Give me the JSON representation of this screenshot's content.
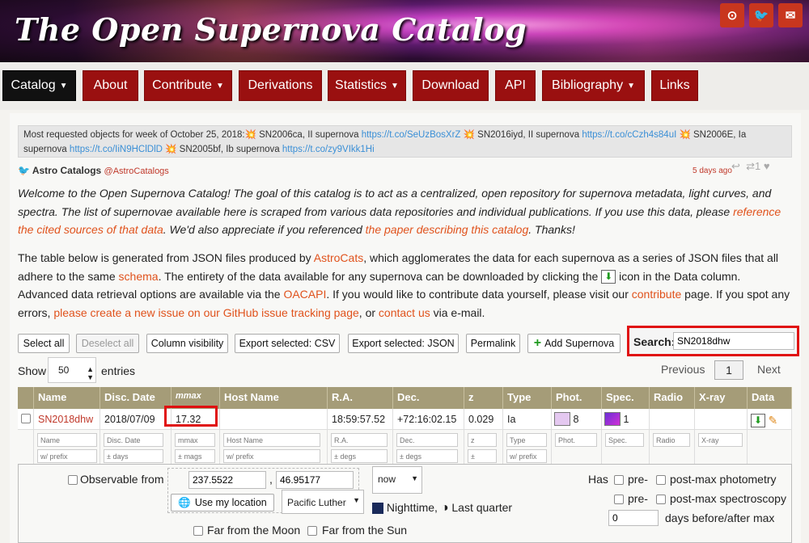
{
  "header": {
    "title": "The Open Supernova Catalog",
    "social": [
      {
        "name": "github-icon",
        "glyph": "⊙"
      },
      {
        "name": "twitter-icon",
        "glyph": "🐦"
      },
      {
        "name": "email-icon",
        "glyph": "✉"
      }
    ]
  },
  "nav": {
    "items": [
      {
        "label": "Catalog",
        "dropdown": true,
        "active": true
      },
      {
        "label": "About",
        "dropdown": false
      },
      {
        "label": "Contribute",
        "dropdown": true
      },
      {
        "label": "Derivations",
        "dropdown": false
      },
      {
        "label": "Statistics",
        "dropdown": true
      },
      {
        "label": "Download",
        "dropdown": false
      },
      {
        "label": "API",
        "dropdown": false
      },
      {
        "label": "Bibliography",
        "dropdown": true
      },
      {
        "label": "Links",
        "dropdown": false
      }
    ]
  },
  "ticker": {
    "intro": "Most requested objects for week of October 25, 2018:",
    "items": [
      {
        "text": "SN2006ca, II supernova",
        "link": "https://t.co/SeUzBosXrZ"
      },
      {
        "text": "SN2016iyd, II supernova",
        "link": "https://t.co/cCzh4s84uI"
      },
      {
        "text": "SN2006E, Ia supernova",
        "link": "https://t.co/IiN9HClDlD"
      },
      {
        "text": "SN2005bf, Ib supernova",
        "link": "https://t.co/zy9VIkk1Hi"
      }
    ]
  },
  "tweet": {
    "user": "Astro Catalogs",
    "handle": "@AstroCatalogs",
    "time": "5 days ago",
    "retweets": "1"
  },
  "intro": {
    "text1": "Welcome to the Open Supernova Catalog! The goal of this catalog is to act as a centralized, open repository for supernova metadata, light curves, and spectra. The list of supernovae available here is scraped from various data repositories and individual publications. If you use this data, please ",
    "link1": "reference the cited sources of that data",
    "text2": ". We'd also appreciate if you referenced ",
    "link2": "the paper describing this catalog",
    "text3": ". Thanks!"
  },
  "para2": {
    "t1": "The table below is generated from JSON files produced by ",
    "l1": "AstroCats",
    "t2": ", which agglomerates the data for each supernova as a series of JSON files that all adhere to the same ",
    "l2": "schema",
    "t3": ". The entirety of the data available for any supernova can be downloaded by clicking the ",
    "t4": " icon in the Data column. Advanced data retrieval options are available via the ",
    "l3": "OACAPI",
    "t5": ". If you would like to contribute data yourself, please visit our ",
    "l4": "contribute",
    "t6": " page. If you spot any errors, ",
    "l5": "please create a new issue on our GitHub issue tracking page",
    "t7": ", or ",
    "l6": "contact us",
    "t8": " via e-mail."
  },
  "toolbar": {
    "select_all": "Select all",
    "deselect_all": "Deselect all",
    "column_visibility": "Column visibility",
    "export_csv": "Export selected: CSV",
    "export_json": "Export selected: JSON",
    "permalink": "Permalink",
    "add_supernova": "Add Supernova",
    "search_label": "Search:",
    "search_value": "SN2018dhw"
  },
  "pagination": {
    "show": "Show",
    "entries_value": "50",
    "entries": "entries",
    "previous": "Previous",
    "page": "1",
    "next": "Next"
  },
  "table": {
    "headers": [
      "",
      "Name",
      "Disc. Date",
      "mmax",
      "Host Name",
      "R.A.",
      "Dec.",
      "z",
      "Type",
      "Phot.",
      "Spec.",
      "Radio",
      "X-ray",
      "Data"
    ],
    "row": {
      "name": "SN2018dhw",
      "disc_date": "2018/07/09",
      "mmax": "17.32",
      "host": "",
      "ra": "18:59:57.52",
      "dec": "+72:16:02.15",
      "z": "0.029",
      "type": "Ia",
      "phot": "8",
      "spec": "1",
      "radio": "",
      "xray": ""
    },
    "filters": {
      "name": [
        "Name",
        "w/ prefix"
      ],
      "disc_date": [
        "Disc. Date",
        "± days"
      ],
      "mmax": [
        "mmax",
        "± mags"
      ],
      "host": [
        "Host Name",
        "w/ prefix"
      ],
      "ra": [
        "R.A.",
        "± degs"
      ],
      "dec": [
        "Dec.",
        "± degs"
      ],
      "z": [
        "z",
        "±"
      ],
      "type": [
        "Type",
        "w/ prefix"
      ],
      "phot": [
        "Phot."
      ],
      "spec": [
        "Spec."
      ],
      "radio": [
        "Radio"
      ],
      "xray": [
        "X-ray"
      ]
    }
  },
  "observe": {
    "observable_from": "Observable from",
    "lat": "237.5522",
    "lon": "46.95177",
    "use_location": "Use my location",
    "time": "now",
    "location": "Pacific Luther",
    "nighttime": "Nighttime,",
    "moon": "Last quarter",
    "far_moon": "Far from the Moon",
    "far_sun": "Far from the Sun",
    "has": "Has",
    "pre": "pre-",
    "post_phot": "post-max photometry",
    "post_spec": "post-max spectroscopy",
    "days_value": "0",
    "days_label": "days before/after max"
  }
}
